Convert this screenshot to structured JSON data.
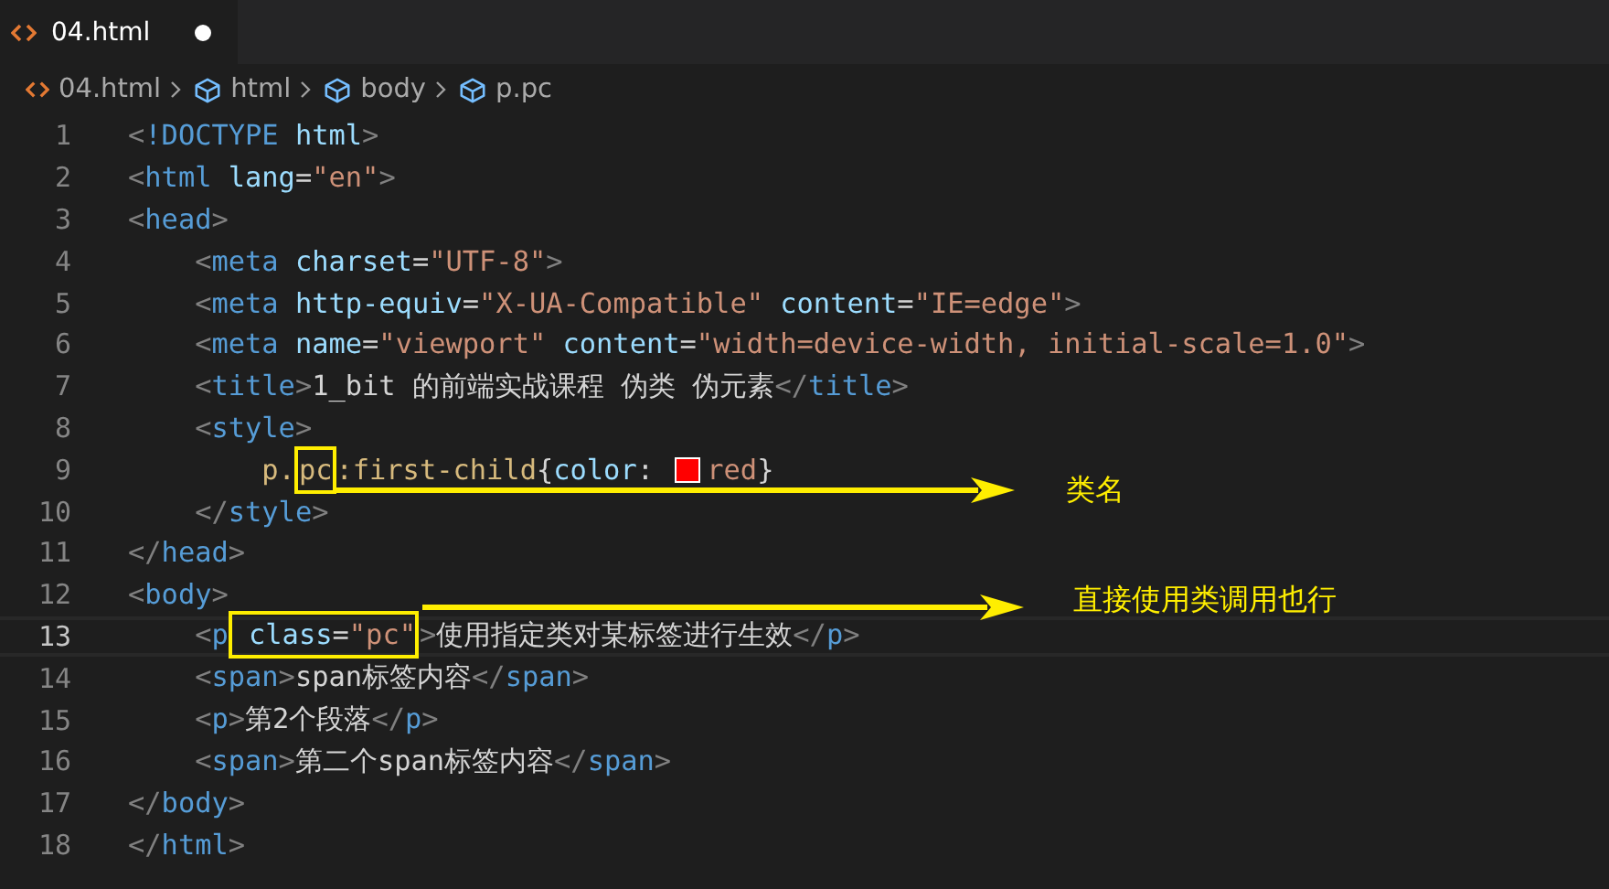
{
  "tab": {
    "label": "04.html",
    "selected": true,
    "modified": true
  },
  "breadcrumb": [
    {
      "kind": "file",
      "label": "04.html"
    },
    {
      "kind": "element",
      "label": "html"
    },
    {
      "kind": "element",
      "label": "body"
    },
    {
      "kind": "element",
      "label": "p.pc"
    }
  ],
  "lines": [
    {
      "number": "1",
      "current": false,
      "tokens": [
        {
          "kind": "p",
          "text": "<"
        },
        {
          "kind": "tag",
          "text": "!DOCTYPE"
        },
        {
          "kind": "attr",
          "text": " html"
        },
        {
          "kind": "p",
          "text": ">"
        }
      ]
    },
    {
      "number": "2",
      "current": false,
      "tokens": [
        {
          "kind": "p",
          "text": "<"
        },
        {
          "kind": "tag",
          "text": "html"
        },
        {
          "kind": "attr",
          "text": " lang"
        },
        {
          "kind": "text",
          "text": "="
        },
        {
          "kind": "str",
          "text": "\"en\""
        },
        {
          "kind": "p",
          "text": ">"
        }
      ]
    },
    {
      "number": "3",
      "current": false,
      "tokens": [
        {
          "kind": "p",
          "text": "<"
        },
        {
          "kind": "tag",
          "text": "head"
        },
        {
          "kind": "p",
          "text": ">"
        }
      ]
    },
    {
      "number": "4",
      "current": false,
      "tokens": [
        {
          "kind": "p",
          "text": "    <"
        },
        {
          "kind": "tag",
          "text": "meta"
        },
        {
          "kind": "attr",
          "text": " charset"
        },
        {
          "kind": "text",
          "text": "="
        },
        {
          "kind": "str",
          "text": "\"UTF-8\""
        },
        {
          "kind": "p",
          "text": ">"
        }
      ]
    },
    {
      "number": "5",
      "current": false,
      "tokens": [
        {
          "kind": "p",
          "text": "    <"
        },
        {
          "kind": "tag",
          "text": "meta"
        },
        {
          "kind": "attr",
          "text": " http-equiv"
        },
        {
          "kind": "text",
          "text": "="
        },
        {
          "kind": "str",
          "text": "\"X-UA-Compatible\""
        },
        {
          "kind": "attr",
          "text": " content"
        },
        {
          "kind": "text",
          "text": "="
        },
        {
          "kind": "str",
          "text": "\"IE=edge\""
        },
        {
          "kind": "p",
          "text": ">"
        }
      ]
    },
    {
      "number": "6",
      "current": false,
      "tokens": [
        {
          "kind": "p",
          "text": "    <"
        },
        {
          "kind": "tag",
          "text": "meta"
        },
        {
          "kind": "attr",
          "text": " name"
        },
        {
          "kind": "text",
          "text": "="
        },
        {
          "kind": "str",
          "text": "\"viewport\""
        },
        {
          "kind": "attr",
          "text": " content"
        },
        {
          "kind": "text",
          "text": "="
        },
        {
          "kind": "str",
          "text": "\"width=device-width, initial-scale=1.0\""
        },
        {
          "kind": "p",
          "text": ">"
        }
      ]
    },
    {
      "number": "7",
      "current": false,
      "tokens": [
        {
          "kind": "p",
          "text": "    <"
        },
        {
          "kind": "tag",
          "text": "title"
        },
        {
          "kind": "p",
          "text": ">"
        },
        {
          "kind": "text",
          "text": "1_bit 的前端实战课程 伪类 伪元素"
        },
        {
          "kind": "p",
          "text": "</"
        },
        {
          "kind": "tag",
          "text": "title"
        },
        {
          "kind": "p",
          "text": ">"
        }
      ]
    },
    {
      "number": "8",
      "current": false,
      "tokens": [
        {
          "kind": "p",
          "text": "    <"
        },
        {
          "kind": "tag",
          "text": "style"
        },
        {
          "kind": "p",
          "text": ">"
        }
      ]
    },
    {
      "number": "9",
      "current": false,
      "tokens": [
        {
          "kind": "sel",
          "text": "        p."
        },
        {
          "kind": "box",
          "tokens": [
            {
              "kind": "sel",
              "text": "pc"
            }
          ]
        },
        {
          "kind": "sel",
          "text": ":first-child"
        },
        {
          "kind": "text",
          "text": "{"
        },
        {
          "kind": "attr",
          "text": "color"
        },
        {
          "kind": "text",
          "text": ": "
        },
        {
          "kind": "swatch",
          "color": "#ff0000"
        },
        {
          "kind": "str",
          "text": "red"
        },
        {
          "kind": "text",
          "text": "}"
        }
      ]
    },
    {
      "number": "10",
      "current": false,
      "tokens": [
        {
          "kind": "p",
          "text": "    </"
        },
        {
          "kind": "tag",
          "text": "style"
        },
        {
          "kind": "p",
          "text": ">"
        }
      ]
    },
    {
      "number": "11",
      "current": false,
      "tokens": [
        {
          "kind": "p",
          "text": "</"
        },
        {
          "kind": "tag",
          "text": "head"
        },
        {
          "kind": "p",
          "text": ">"
        }
      ]
    },
    {
      "number": "12",
      "current": false,
      "tokens": [
        {
          "kind": "p",
          "text": "<"
        },
        {
          "kind": "tag",
          "text": "body"
        },
        {
          "kind": "p",
          "text": ">"
        }
      ]
    },
    {
      "number": "13",
      "current": true,
      "tokens": [
        {
          "kind": "p",
          "text": "    <"
        },
        {
          "kind": "tag",
          "text": "p"
        },
        {
          "kind": "box",
          "tokens": [
            {
              "kind": "attr",
              "text": " class"
            },
            {
              "kind": "text",
              "text": "="
            },
            {
              "kind": "str",
              "text": "\"pc\""
            }
          ]
        },
        {
          "kind": "p",
          "text": ">"
        },
        {
          "kind": "text",
          "text": "使用指定类对某标签进行生效"
        },
        {
          "kind": "p",
          "text": "</"
        },
        {
          "kind": "tag",
          "text": "p"
        },
        {
          "kind": "p",
          "text": ">"
        }
      ]
    },
    {
      "number": "14",
      "current": false,
      "tokens": [
        {
          "kind": "p",
          "text": "    <"
        },
        {
          "kind": "tag",
          "text": "span"
        },
        {
          "kind": "p",
          "text": ">"
        },
        {
          "kind": "text",
          "text": "span标签内容"
        },
        {
          "kind": "p",
          "text": "</"
        },
        {
          "kind": "tag",
          "text": "span"
        },
        {
          "kind": "p",
          "text": ">"
        }
      ]
    },
    {
      "number": "15",
      "current": false,
      "tokens": [
        {
          "kind": "p",
          "text": "    <"
        },
        {
          "kind": "tag",
          "text": "p"
        },
        {
          "kind": "p",
          "text": ">"
        },
        {
          "kind": "text",
          "text": "第2个段落"
        },
        {
          "kind": "p",
          "text": "</"
        },
        {
          "kind": "tag",
          "text": "p"
        },
        {
          "kind": "p",
          "text": ">"
        }
      ]
    },
    {
      "number": "16",
      "current": false,
      "tokens": [
        {
          "kind": "p",
          "text": "    <"
        },
        {
          "kind": "tag",
          "text": "span"
        },
        {
          "kind": "p",
          "text": ">"
        },
        {
          "kind": "text",
          "text": "第二个span标签内容"
        },
        {
          "kind": "p",
          "text": "</"
        },
        {
          "kind": "tag",
          "text": "span"
        },
        {
          "kind": "p",
          "text": ">"
        }
      ]
    },
    {
      "number": "17",
      "current": false,
      "tokens": [
        {
          "kind": "p",
          "text": "</"
        },
        {
          "kind": "tag",
          "text": "body"
        },
        {
          "kind": "p",
          "text": ">"
        }
      ]
    },
    {
      "number": "18",
      "current": false,
      "tokens": [
        {
          "kind": "p",
          "text": "</"
        },
        {
          "kind": "tag",
          "text": "html"
        },
        {
          "kind": "p",
          "text": ">"
        }
      ]
    }
  ],
  "annotations": [
    {
      "text": "类名"
    },
    {
      "text": "直接使用类调用也行"
    }
  ]
}
